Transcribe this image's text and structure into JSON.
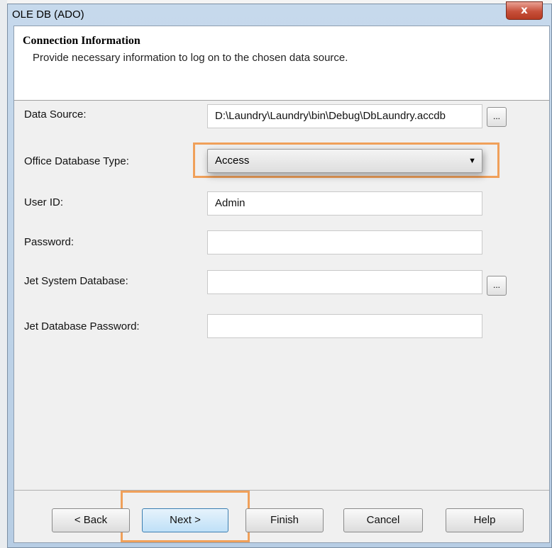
{
  "window": {
    "title": "OLE DB (ADO)",
    "close_glyph": "x"
  },
  "header": {
    "title": "Connection Information",
    "subtitle": "Provide necessary information to log on to the chosen data source."
  },
  "fields": {
    "data_source": {
      "label": "Data Source:",
      "value": "D:\\Laundry\\Laundry\\bin\\Debug\\DbLaundry.accdb"
    },
    "office_db_type": {
      "label": "Office Database Type:",
      "value": "Access"
    },
    "user_id": {
      "label": "User ID:",
      "value": "Admin"
    },
    "password": {
      "label": "Password:",
      "value": ""
    },
    "jet_system_db": {
      "label": "Jet System Database:",
      "value": ""
    },
    "jet_db_password": {
      "label": "Jet Database Password:",
      "value": ""
    }
  },
  "browse_label": "...",
  "buttons": {
    "back": "< Back",
    "next": "Next >",
    "finish": "Finish",
    "cancel": "Cancel",
    "help": "Help"
  },
  "colors": {
    "highlight": "#f0a05a",
    "close_button": "#c7503a",
    "default_button_border": "#3c7fb1"
  }
}
